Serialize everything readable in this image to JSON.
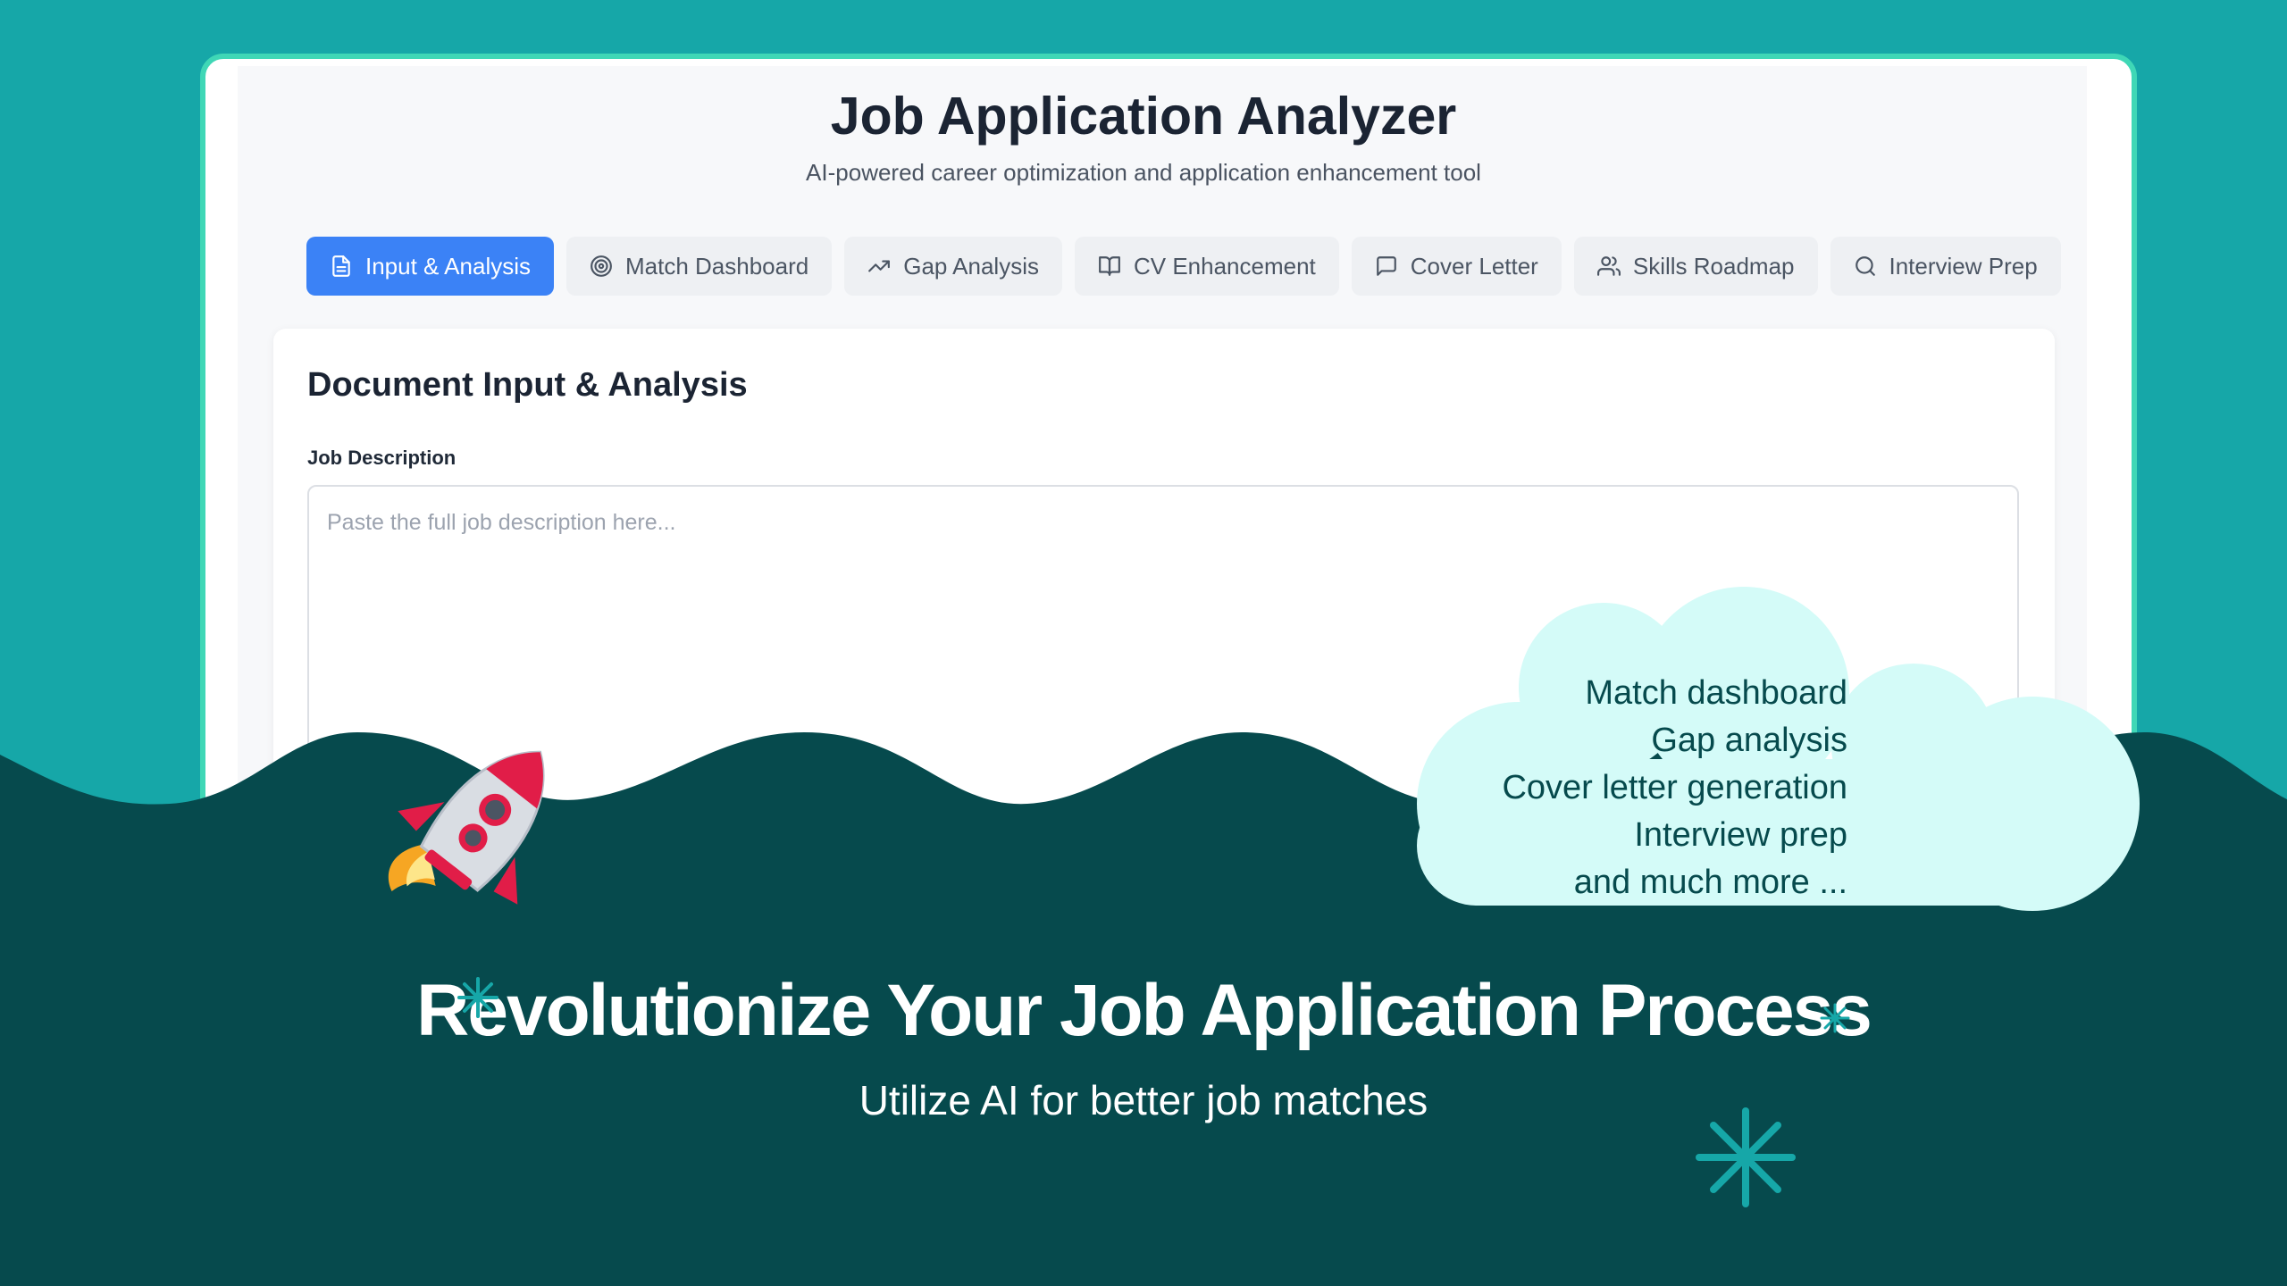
{
  "app": {
    "title": "Job Application Analyzer",
    "subtitle": "AI-powered career optimization and application enhancement tool"
  },
  "tabs": [
    {
      "label": "Input & Analysis",
      "icon": "document-icon",
      "active": true
    },
    {
      "label": "Match Dashboard",
      "icon": "target-icon",
      "active": false
    },
    {
      "label": "Gap Analysis",
      "icon": "trending-up-icon",
      "active": false
    },
    {
      "label": "CV Enhancement",
      "icon": "book-open-icon",
      "active": false
    },
    {
      "label": "Cover Letter",
      "icon": "message-square-icon",
      "active": false
    },
    {
      "label": "Skills Roadmap",
      "icon": "users-icon",
      "active": false
    },
    {
      "label": "Interview Prep",
      "icon": "search-icon",
      "active": false
    }
  ],
  "panel": {
    "title": "Document Input & Analysis",
    "job_description_label": "Job Description",
    "job_description_placeholder": "Paste the full job description here...",
    "job_description_value": ""
  },
  "cloud_features": [
    "Match dashboard",
    "Gap analysis",
    "Cover letter generation",
    "Interview prep",
    "and much more ..."
  ],
  "promo": {
    "headline": "Revolutionize Your Job Application Process",
    "subheadline": "Utilize AI for better job matches"
  },
  "colors": {
    "background_teal": "#16a7a8",
    "frame_border": "#3fd7b6",
    "wave_dark": "#064a4d",
    "active_tab": "#3b82f6",
    "cloud_fill": "#d4fbf8"
  }
}
